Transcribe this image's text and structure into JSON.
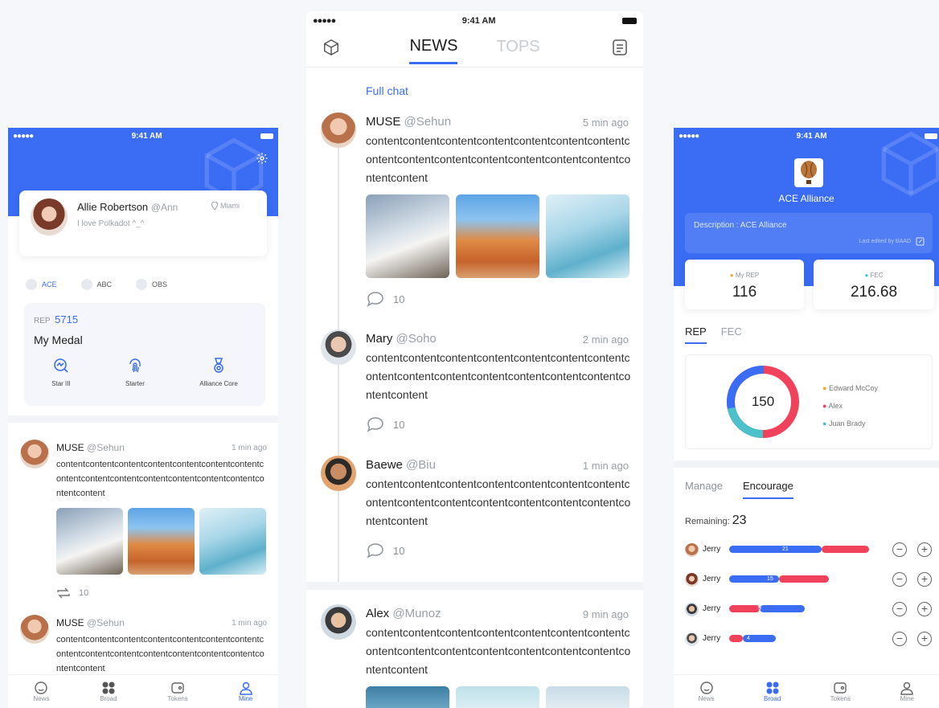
{
  "middle": {
    "status": {
      "signal": "●●●●●",
      "time": "9:41 AM"
    },
    "tabs": [
      {
        "label": "NEWS"
      },
      {
        "label": "TOPS"
      }
    ],
    "full_chat": "Full chat",
    "posts": [
      {
        "name": "MUSE",
        "handle": "@Sehun",
        "time": "5 min ago",
        "body": "contentcontentcontentcontentcontentcontentcontentcontentcontentcontentcontentcontentcontentcontentcontentcontent",
        "comments": "10"
      },
      {
        "name": "Mary",
        "handle": "@Soho",
        "time": "2 min ago",
        "body": "contentcontentcontentcontentcontentcontentcontentcontentcontentcontentcontentcontentcontentcontentcontentcontent",
        "comments": "10"
      },
      {
        "name": "Baewe",
        "handle": "@Biu",
        "time": "1 min ago",
        "body": "contentcontentcontentcontentcontentcontentcontentcontentcontentcontentcontentcontentcontentcontentcontentcontent",
        "comments": "10"
      },
      {
        "name": "Alex",
        "handle": "@Munoz",
        "time": "9 min ago",
        "body": "contentcontentcontentcontentcontentcontentcontentcontentcontentcontentcontentcontentcontentcontentcontentcontent"
      }
    ]
  },
  "left": {
    "status": {
      "signal": "●●●●●",
      "time": "9:41 AM"
    },
    "profile": {
      "name": "Allie Robertson",
      "handle": "@Ann",
      "location": "Miami",
      "bio": "I love Polkadot ^_^"
    },
    "chips": [
      "ACE",
      "ABC",
      "OBS"
    ],
    "rep_label": "REP",
    "rep_value": "5715",
    "medal_title": "My Medal",
    "medals": [
      "Star III",
      "Starter",
      "Alliance Core"
    ],
    "posts": [
      {
        "name": "MUSE",
        "handle": "@Sehun",
        "time": "1 min ago",
        "body": "contentcontentcontentcontentcontentcontentcontentcontentcontentcontentcontentcontentcontentcontentcontentcontent",
        "reposts": "10"
      },
      {
        "name": "MUSE",
        "handle": "@Sehun",
        "time": "1 min ago",
        "body": "contentcontentcontentcontentcontentcontentcontentcontentcontentcontentcontentcontentcontentcontentcontentcontent"
      }
    ],
    "tabbar": [
      "News",
      "Broad",
      "Tokens",
      "Mine"
    ]
  },
  "right": {
    "status": {
      "signal": "●●●●●",
      "time": "9:41 AM"
    },
    "alliance_name": "ACE Alliance",
    "description": "Description : ACE Alliance",
    "last_edited": "Last edited by BAAD",
    "stats": [
      {
        "label": "My REP",
        "value": "116",
        "color": "#f5a623"
      },
      {
        "label": "FEC",
        "value": "216.68",
        "color": "#3ec6e0"
      }
    ],
    "tabs": [
      "REP",
      "FEC"
    ],
    "donut_total": "150",
    "legend": [
      {
        "name": "Edward McCoy",
        "color": "#f5a623"
      },
      {
        "name": "Alex",
        "color": "#f0425a"
      },
      {
        "name": "Juan Brady",
        "color": "#4cc1c9"
      }
    ],
    "subtabs": [
      "Manage",
      "Encourage"
    ],
    "remaining_label": "Remaining:",
    "remaining_value": "23",
    "rows": [
      {
        "name": "Jerry",
        "value": "21",
        "blue": 0.66,
        "red": 0.34
      },
      {
        "name": "Jerry",
        "value": "15",
        "blue": 0.5,
        "red": 0.5
      },
      {
        "name": "Jerry",
        "value": "9",
        "red": 0.4,
        "blue": 0.6
      },
      {
        "name": "Jerry",
        "value": "4",
        "red": 0.3,
        "blue": 0.7
      }
    ],
    "tabbar": [
      "News",
      "Broad",
      "Tokens",
      "Mine"
    ]
  }
}
